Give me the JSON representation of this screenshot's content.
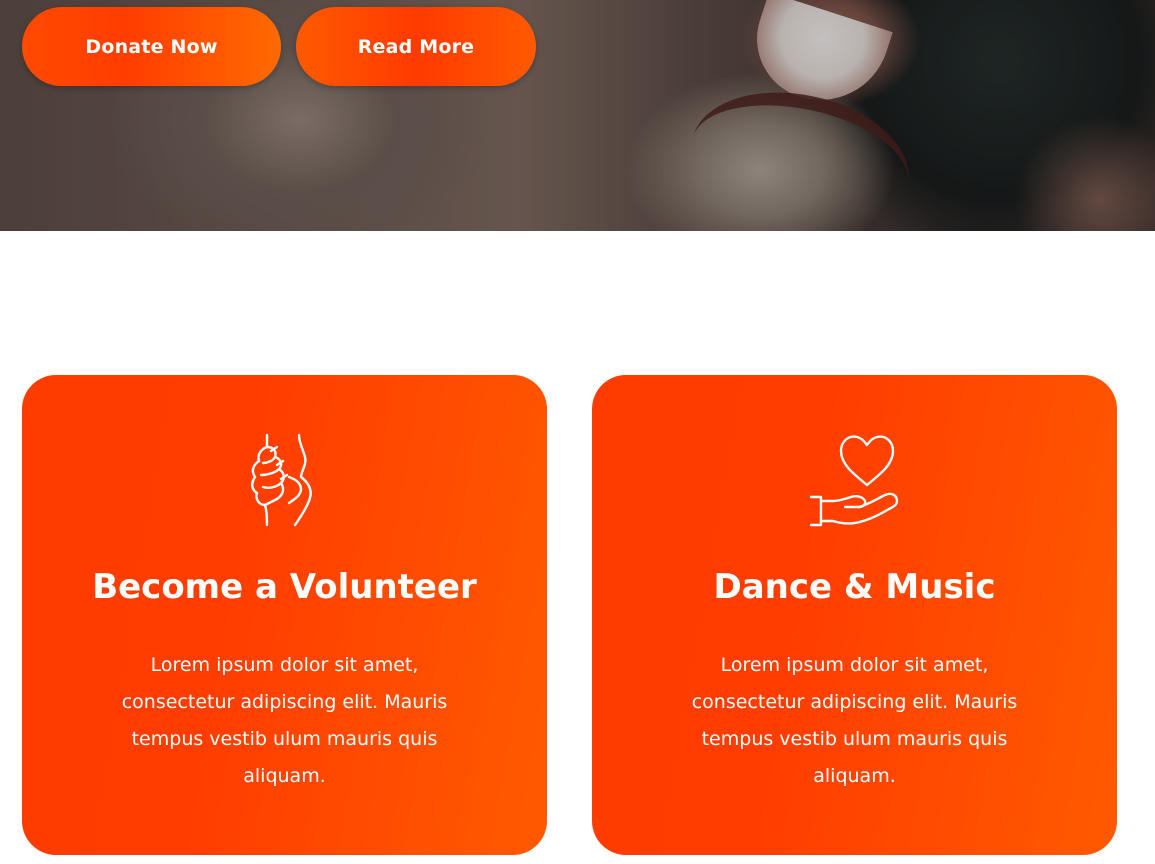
{
  "hero": {
    "buttons": {
      "donate_label": "Donate Now",
      "read_more_label": "Read More"
    }
  },
  "cards": [
    {
      "icon": "helping-hands-icon",
      "title": "Become a Volunteer",
      "description": "Lorem ipsum dolor sit amet, consectetur adipiscing elit. Mauris tempus vestib ulum mauris quis aliquam."
    },
    {
      "icon": "heart-in-hand-icon",
      "title": "Dance & Music",
      "description": "Lorem ipsum dolor sit amet, consectetur adipiscing elit. Mauris tempus vestib ulum mauris quis aliquam."
    }
  ],
  "colors": {
    "accent": "#ff3d00",
    "accent_light": "#ff5a00",
    "text_on_accent": "#ffffff"
  }
}
